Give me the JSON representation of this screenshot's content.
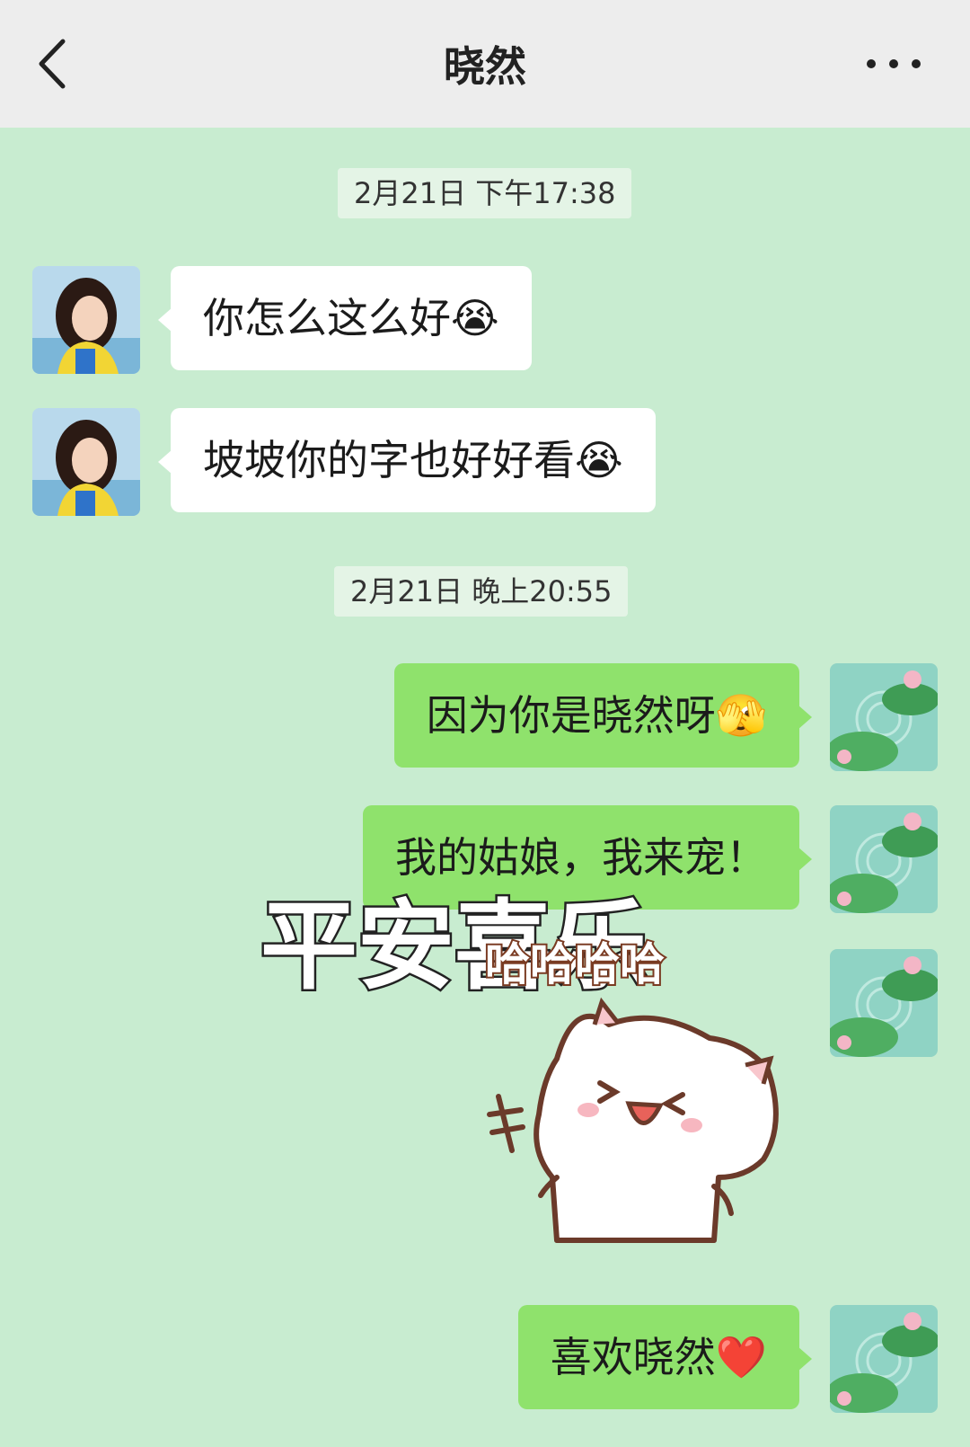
{
  "header": {
    "title": "晓然"
  },
  "timestamps": [
    "2月21日 下午17:38",
    "2月21日 晚上20:55"
  ],
  "messages": [
    {
      "side": "left",
      "text": "你怎么这么好",
      "emoji": "😭"
    },
    {
      "side": "left",
      "text": "坡坡你的字也好好看",
      "emoji": "😭"
    },
    {
      "side": "right",
      "text": "因为你是晓然呀",
      "emoji": "🫣"
    },
    {
      "side": "right",
      "text": "我的姑娘，我来宠！",
      "emoji": ""
    },
    {
      "side": "right",
      "text": "喜欢晓然",
      "emoji": "❤️"
    }
  ],
  "sticker": {
    "big_text": "平安喜乐",
    "small_text": "哈哈哈哈"
  },
  "colors": {
    "background": "#c8ecd0",
    "header": "#ededed",
    "left_bubble": "#ffffff",
    "right_bubble": "#8fe26c"
  },
  "icons": [
    "back-chevron-icon",
    "more-dots-icon"
  ]
}
